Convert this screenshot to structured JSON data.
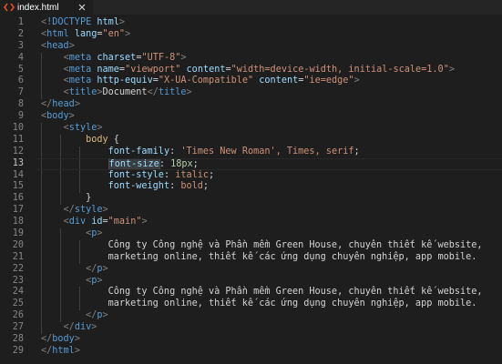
{
  "tab": {
    "icon": "code-icon",
    "filename": "index.html",
    "close_icon": "close-icon"
  },
  "editor": {
    "current_line": 13,
    "lines": [
      {
        "n": "1",
        "t": "<!DOCTYPE html>"
      },
      {
        "n": "2",
        "t": "<html lang=\"en\">"
      },
      {
        "n": "3",
        "t": "<head>"
      },
      {
        "n": "4",
        "t": "    <meta charset=\"UTF-8\">"
      },
      {
        "n": "5",
        "t": "    <meta name=\"viewport\" content=\"width=device-width, initial-scale=1.0\">"
      },
      {
        "n": "6",
        "t": "    <meta http-equiv=\"X-UA-Compatible\" content=\"ie=edge\">"
      },
      {
        "n": "7",
        "t": "    <title>Document</title>"
      },
      {
        "n": "8",
        "t": "</head>"
      },
      {
        "n": "9",
        "t": "<body>"
      },
      {
        "n": "10",
        "t": "    <style>"
      },
      {
        "n": "11",
        "t": "        body {"
      },
      {
        "n": "12",
        "t": "            font-family: 'Times New Roman', Times, serif;"
      },
      {
        "n": "13",
        "t": "            font-size: 18px;"
      },
      {
        "n": "14",
        "t": "            font-style: italic;"
      },
      {
        "n": "15",
        "t": "            font-weight: bold;"
      },
      {
        "n": "16",
        "t": "        }"
      },
      {
        "n": "17",
        "t": "    </style>"
      },
      {
        "n": "18",
        "t": "    <div id=\"main\">"
      },
      {
        "n": "19",
        "t": "        <p>"
      },
      {
        "n": "20",
        "t": "            Công ty Công nghệ và Phần mềm Green House, chuyên thiết kế website,"
      },
      {
        "n": "21",
        "t": "            marketing online, thiết kế các ứng dụng chuyên nghiệp, app mobile."
      },
      {
        "n": "22",
        "t": "        </p>"
      },
      {
        "n": "23",
        "t": "        <p>"
      },
      {
        "n": "24",
        "t": "            Công ty Công nghệ và Phần mềm Green House, chuyên thiết kế website,"
      },
      {
        "n": "25",
        "t": "            marketing online, thiết kế các ứng dụng chuyên nghiệp, app mobile."
      },
      {
        "n": "26",
        "t": "        </p>"
      },
      {
        "n": "27",
        "t": "    </div>"
      },
      {
        "n": "28",
        "t": "</body>"
      },
      {
        "n": "29",
        "t": "</html>"
      }
    ]
  },
  "colors": {
    "background": "#1e1e1e",
    "tag": "#569cd6",
    "attribute": "#9cdcfe",
    "string": "#ce9178",
    "selector": "#d7ba7d",
    "number": "#b5cea8",
    "text": "#d4d4d4"
  }
}
